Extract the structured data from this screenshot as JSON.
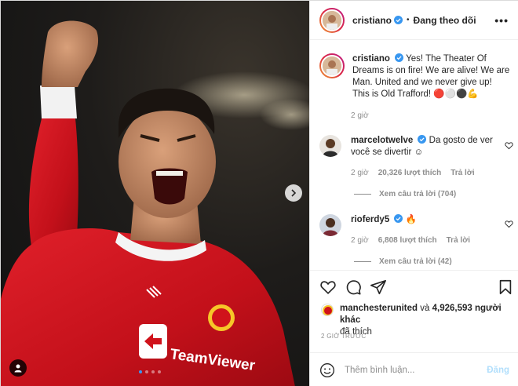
{
  "post": {
    "author": "cristiano",
    "follow_state": "Đang theo dõi",
    "separator": "•",
    "more_icon": "more-horizontal-icon"
  },
  "caption": {
    "username": "cristiano",
    "text": "Yes! The Theater Of Dreams is on fire! We are alive! We are Man. United and we never give up! This is Old Trafford! 🔴⚪⚫💪",
    "time": "2 giờ"
  },
  "comments": [
    {
      "username": "marcelotwelve",
      "text": "Da gosto de ver você se divertir ☺",
      "time": "2 giờ",
      "likes": "20,326 lượt thích",
      "reply_label": "Trả lời",
      "view_replies": "Xem câu trả lời (704)"
    },
    {
      "username": "rioferdy5",
      "text": "🔥",
      "time": "2 giờ",
      "likes": "6,808 lượt thích",
      "reply_label": "Trả lời",
      "view_replies": "Xem câu trả lời (42)"
    }
  ],
  "likes_summary": {
    "account": "manchesterunited",
    "connector": "và",
    "count_text": "4,926,593 người khác",
    "suffix": "đã thích"
  },
  "time_ago": "2 GIỜ TRƯỚC",
  "comment_box": {
    "placeholder": "Thêm bình luận...",
    "post_label": "Đăng"
  },
  "photo": {
    "jersey_text": "TeamViewer",
    "carousel_count": 4,
    "carousel_active": 1
  },
  "colors": {
    "verified": "#3897f0",
    "jersey_red": "#d0121b",
    "post_button_disabled": "#b2dffc",
    "secondary_text": "#8e8e8e"
  }
}
